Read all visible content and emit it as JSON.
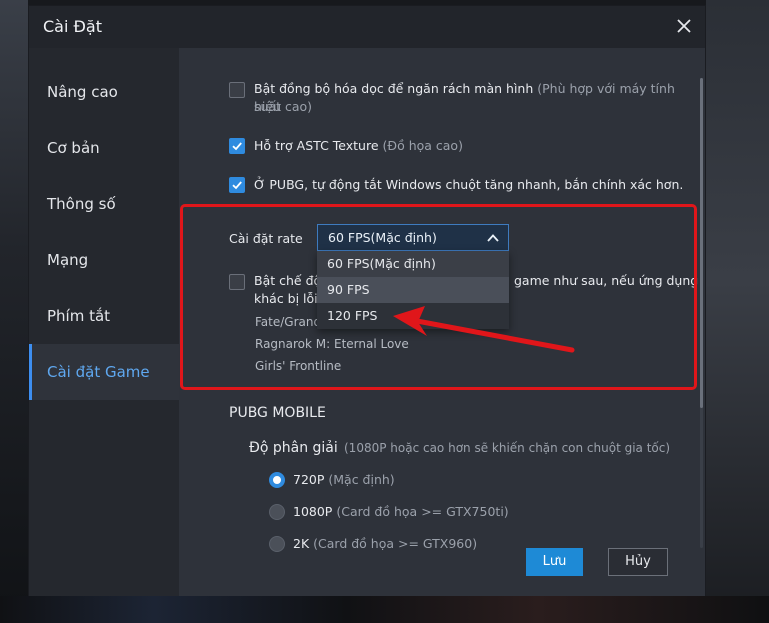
{
  "window": {
    "title": "Cài Đặt"
  },
  "sidebar": {
    "items": [
      {
        "label": "Nâng cao",
        "active": false
      },
      {
        "label": "Cơ bản",
        "active": false
      },
      {
        "label": "Thông số",
        "active": false
      },
      {
        "label": "Mạng",
        "active": false
      },
      {
        "label": "Phím tắt",
        "active": false
      },
      {
        "label": "Cài đặt Game",
        "active": true
      }
    ]
  },
  "settings": {
    "vsync": {
      "label": "Bật đồng bộ hóa dọc để ngăn rách màn hình",
      "hint1": "(Phù hợp với máy tính hiệu",
      "hint2": "suất cao)",
      "checked": false
    },
    "astc": {
      "label": "Hỗ trợ ASTC Texture",
      "hint": "(Đồ họa cao)",
      "checked": true
    },
    "pubg_mouse": {
      "label": "Ở PUBG, tự động tắt Windows chuột tăng nhanh, bắn chính xác hơn.",
      "checked": true
    },
    "rate": {
      "label": "Cài đặt rate",
      "selected": "60 FPS(Mặc định)",
      "options": [
        "60 FPS(Mặc định)",
        "90 FPS",
        "120 FPS"
      ]
    },
    "compat": {
      "label_start": "Bật chế độ",
      "label_end": "game như sau, nếu ứng dụng",
      "line2": "khác bị lỗi",
      "checked": false,
      "games": [
        "Fate/Grand",
        "Ragnarok M: Eternal Love",
        "Girls' Frontline"
      ]
    }
  },
  "pubg": {
    "section_title": "PUBG MOBILE",
    "resolution_label": "Độ phân giải",
    "resolution_hint": "(1080P hoặc cao hơn sẽ khiến chặn con chuột gia tốc)",
    "options": [
      {
        "label": "720P",
        "hint": "(Mặc định)",
        "checked": true
      },
      {
        "label": "1080P",
        "hint": "(Card đồ họa >= GTX750ti)",
        "checked": false
      },
      {
        "label": "2K",
        "hint": "(Card đồ họa >= GTX960)",
        "checked": false
      }
    ]
  },
  "buttons": {
    "save": "Lưu",
    "cancel": "Hủy"
  },
  "colors": {
    "accent": "#2f8bdf",
    "annotation": "#e0161a"
  }
}
